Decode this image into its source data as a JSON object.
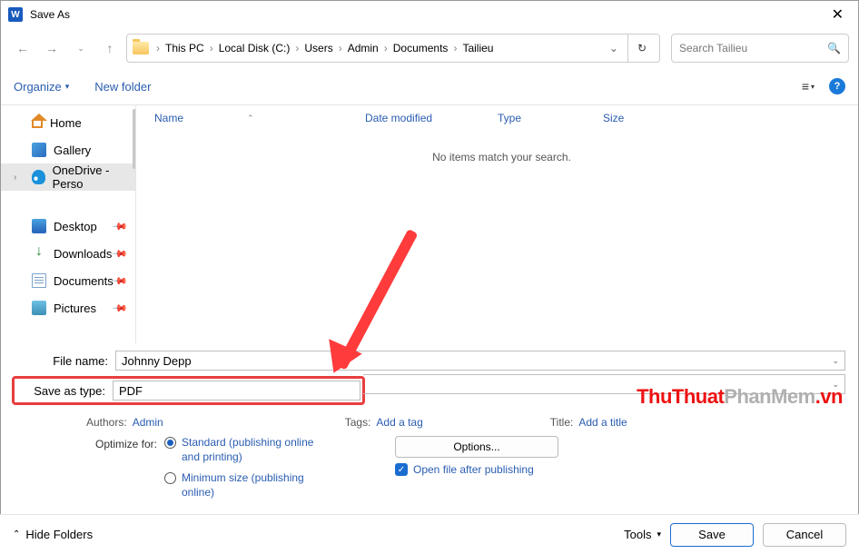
{
  "titlebar": {
    "title": "Save As"
  },
  "breadcrumb": {
    "items": [
      "This PC",
      "Local Disk (C:)",
      "Users",
      "Admin",
      "Documents",
      "Tailieu"
    ]
  },
  "search": {
    "placeholder": "Search Tailieu"
  },
  "toolbar": {
    "organize": "Organize",
    "newfolder": "New folder"
  },
  "sidebar": {
    "home": "Home",
    "gallery": "Gallery",
    "onedrive": "OneDrive - Perso",
    "desktop": "Desktop",
    "downloads": "Downloads",
    "documents": "Documents",
    "pictures": "Pictures"
  },
  "columns": {
    "name": "Name",
    "date": "Date modified",
    "type": "Type",
    "size": "Size"
  },
  "list": {
    "empty": "No items match your search."
  },
  "fields": {
    "filename_label": "File name:",
    "filename_value": "Johnny Depp",
    "savetype_label": "Save as type:",
    "savetype_value": "PDF"
  },
  "meta": {
    "authors_label": "Authors:",
    "authors_value": "Admin",
    "tags_label": "Tags:",
    "tags_value": "Add a tag",
    "title_label": "Title:",
    "title_value": "Add a title"
  },
  "optimize": {
    "label": "Optimize for:",
    "standard": "Standard (publishing online and printing)",
    "minimum": "Minimum size (publishing online)"
  },
  "options": {
    "button": "Options...",
    "openafter": "Open file after publishing"
  },
  "footer": {
    "hide": "Hide Folders",
    "tools": "Tools",
    "save": "Save",
    "cancel": "Cancel"
  },
  "watermark": {
    "a": "ThuThuat",
    "b": "PhanMem",
    "c": ".vn"
  }
}
